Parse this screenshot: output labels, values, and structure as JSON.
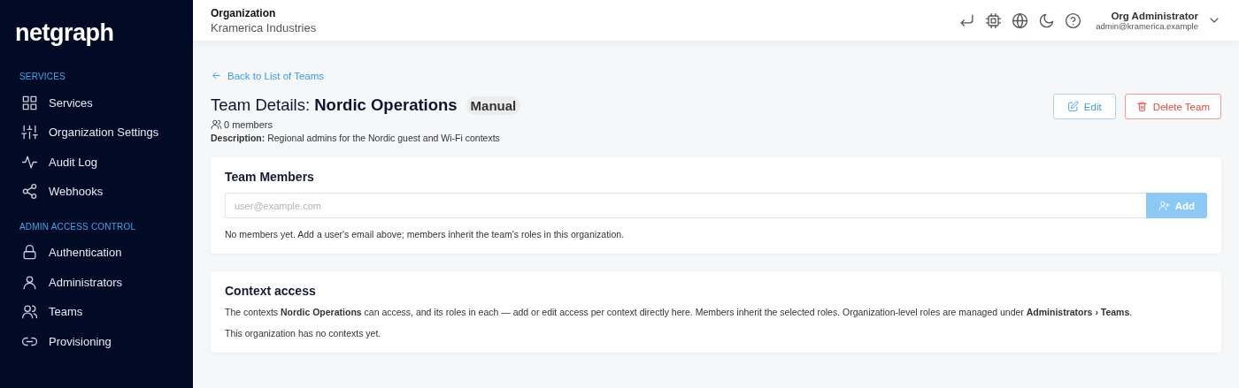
{
  "sidebar": {
    "logo": "netgraph",
    "sections": [
      {
        "heading": "SERVICES",
        "items": [
          {
            "label": "Services",
            "selected": false
          },
          {
            "label": "Organization Settings",
            "selected": false
          },
          {
            "label": "Audit Log",
            "selected": false
          },
          {
            "label": "Webhooks",
            "selected": false
          }
        ]
      },
      {
        "heading": "ADMIN ACCESS CONTROL",
        "items": [
          {
            "label": "Authentication",
            "selected": false
          },
          {
            "label": "Administrators",
            "selected": false
          },
          {
            "label": "Teams",
            "selected": false
          },
          {
            "label": "Provisioning",
            "selected": false
          }
        ]
      }
    ]
  },
  "topbar": {
    "org_label": "Organization",
    "org_name": "Kramerica Industries",
    "user_name": "Org Administrator",
    "user_email": "admin@kramerica.example"
  },
  "header": {
    "back_link": "Back to List of Teams",
    "title_prefix": "Team Details:",
    "title_name": "Nordic Operations",
    "badge": "Manual",
    "members_count": "0 members",
    "description": "**Description:** Regional admins for the Nordic guest and Wi-Fi contexts",
    "edit_button": "Edit",
    "delete_button": "Delete Team"
  },
  "team_members": {
    "title": "Team Members",
    "placeholder": "user@example.com",
    "add_button": {
      "label": "Add",
      "disabled": true
    },
    "empty_text": "No members yet. Add a user's email above; members inherit the team's roles in this organization."
  },
  "context_access": {
    "title": "Context access",
    "intro": "The contexts **Nordic Operations** can access, and its roles in each — add or edit access per context directly here. Members inherit the selected roles. Organization-level roles are managed under **Administrators › Teams**.",
    "empty_text": "This organization has no contexts yet."
  }
}
